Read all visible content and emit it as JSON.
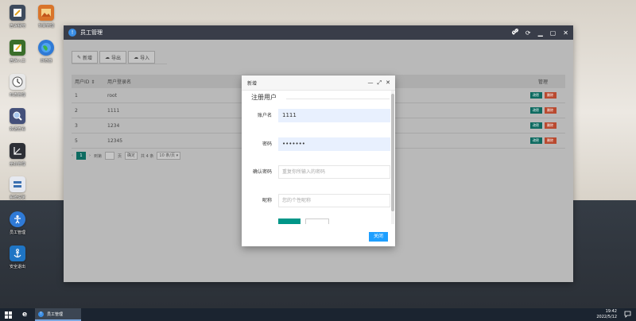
{
  "desktop": {
    "icons": [
      {
        "label": "告诉我吧",
        "icon": "notepad-icon",
        "color": "#3d4a5c"
      },
      {
        "label": "背景管理",
        "icon": "picture-icon",
        "color": "#d9742a"
      },
      {
        "label": "告诉入口",
        "icon": "pencil-icon",
        "color": "#3a6e2a"
      },
      {
        "label": "浏览器",
        "icon": "globe-icon",
        "color": "#2f7ad6"
      },
      {
        "label": "时态管理",
        "icon": "clock-icon",
        "color": "#e8e8e8"
      },
      {
        "label": "数据查看",
        "icon": "magnifier-icon",
        "color": "#44507a"
      },
      {
        "label": "坐标管理",
        "icon": "axis-icon",
        "color": "#2d2f36"
      },
      {
        "label": "系统设定",
        "icon": "settings-panel-icon",
        "color": "#e6e9f0"
      },
      {
        "label": "员工管理",
        "icon": "person-icon",
        "color": "#2f7ad6"
      },
      {
        "label": "安全退出",
        "icon": "anchor-icon",
        "color": "#1f75c4"
      }
    ]
  },
  "window": {
    "title": "员工管理",
    "toolbar": {
      "add": "新增",
      "export": "导出",
      "import": "导入"
    },
    "table": {
      "headers": [
        "用户ID",
        "用户登录名",
        "管理"
      ],
      "rows": [
        {
          "id": "1",
          "login": "root"
        },
        {
          "id": "2",
          "login": "1111"
        },
        {
          "id": "3",
          "login": "1234"
        },
        {
          "id": "5",
          "login": "12345"
        }
      ],
      "edit_label": "改密",
      "delete_label": "删除"
    },
    "pager": {
      "current": "1",
      "goto_label": "到第",
      "page_unit": "页",
      "confirm": "确定",
      "total": "共 4 条",
      "page_size": "10 条/页"
    }
  },
  "modal": {
    "title": "新增",
    "legend": "注册用户",
    "fields": [
      {
        "label": "账户名",
        "value": "1111",
        "placeholder": ""
      },
      {
        "label": "密码",
        "value": "•••••••",
        "placeholder": ""
      },
      {
        "label": "确认密码",
        "value": "",
        "placeholder": "重复你所输入的密码"
      },
      {
        "label": "昵称",
        "value": "",
        "placeholder": "您的个性昵称"
      }
    ],
    "close_label": "关闭"
  },
  "taskbar": {
    "task_label": "员工管理",
    "time": "19:42",
    "date": "2022/5/12"
  }
}
